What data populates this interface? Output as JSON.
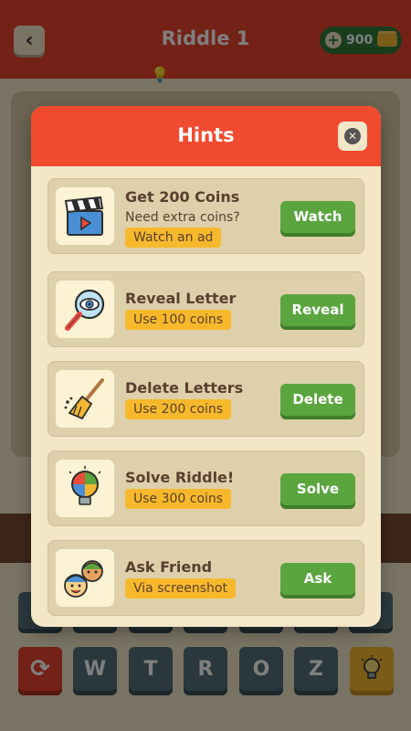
{
  "header": {
    "title": "Riddle 1",
    "coins": "900"
  },
  "tiles": {
    "row": [
      "W",
      "T",
      "R",
      "O",
      "Z"
    ]
  },
  "modal": {
    "title": "Hints",
    "hints": [
      {
        "title": "Get 200 Coins",
        "subtitle": "Need extra coins?",
        "tag": "Watch an ad",
        "button": "Watch",
        "icon": "clapperboard-icon"
      },
      {
        "title": "Reveal Letter",
        "tag": "Use 100 coins",
        "button": "Reveal",
        "icon": "magnifier-eye-icon"
      },
      {
        "title": "Delete Letters",
        "tag": "Use 200 coins",
        "button": "Delete",
        "icon": "broom-icon"
      },
      {
        "title": "Solve Riddle!",
        "tag": "Use 300 coins",
        "button": "Solve",
        "icon": "puzzle-bulb-icon"
      },
      {
        "title": "Ask Friend",
        "tag": "Via screenshot",
        "button": "Ask",
        "icon": "friends-icon"
      }
    ]
  },
  "colors": {
    "primary_red": "#f04a2f",
    "button_green": "#5aa53e",
    "tag_yellow": "#f7b92b",
    "cream": "#f3e7c8"
  }
}
